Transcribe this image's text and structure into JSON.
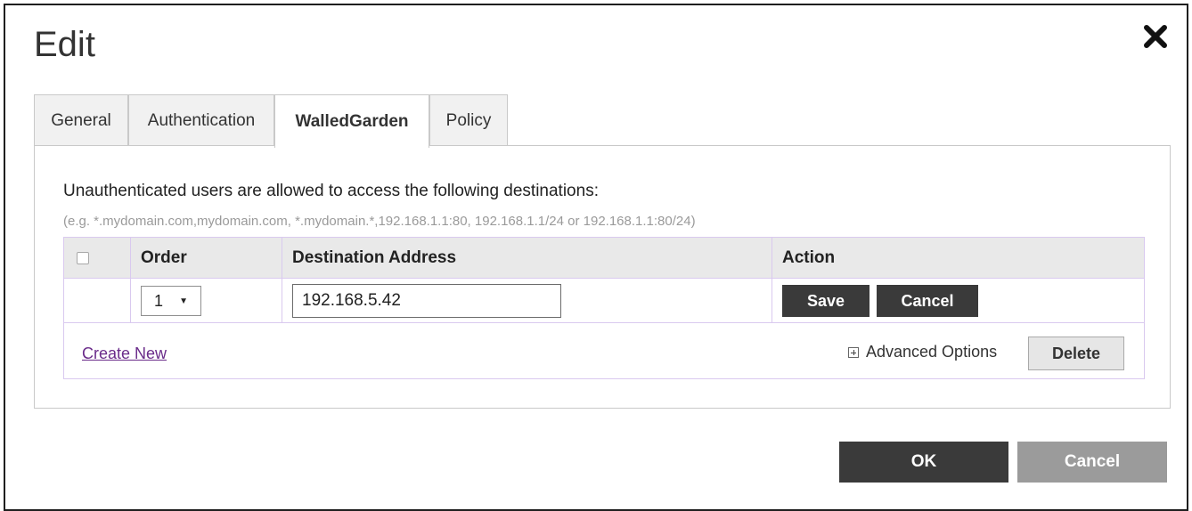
{
  "dialog": {
    "title": "Edit",
    "close_icon": "close-icon"
  },
  "tabs": [
    {
      "label": "General",
      "active": false
    },
    {
      "label": "Authentication",
      "active": false
    },
    {
      "label": "WalledGarden",
      "active": true
    },
    {
      "label": "Policy",
      "active": false
    }
  ],
  "walled_garden": {
    "intro": "Unauthenticated users are allowed to access the following destinations:",
    "hint": "(e.g. *.mydomain.com,mydomain.com, *.mydomain.*,192.168.1.1:80, 192.168.1.1/24 or 192.168.1.1:80/24)",
    "table": {
      "headers": {
        "order": "Order",
        "destination": "Destination Address",
        "action": "Action"
      },
      "row": {
        "order_value": "1",
        "destination_value": "192.168.5.42",
        "save_label": "Save",
        "cancel_label": "Cancel"
      }
    },
    "footer": {
      "create_new": "Create New",
      "advanced_options": "Advanced Options",
      "delete_label": "Delete"
    }
  },
  "buttons": {
    "ok": "OK",
    "cancel": "Cancel"
  },
  "colors": {
    "dark_button": "#3a3a3a",
    "disabled_button": "#9b9b9b",
    "grid_border": "#d9c9ef",
    "link": "#6a2b8a"
  }
}
